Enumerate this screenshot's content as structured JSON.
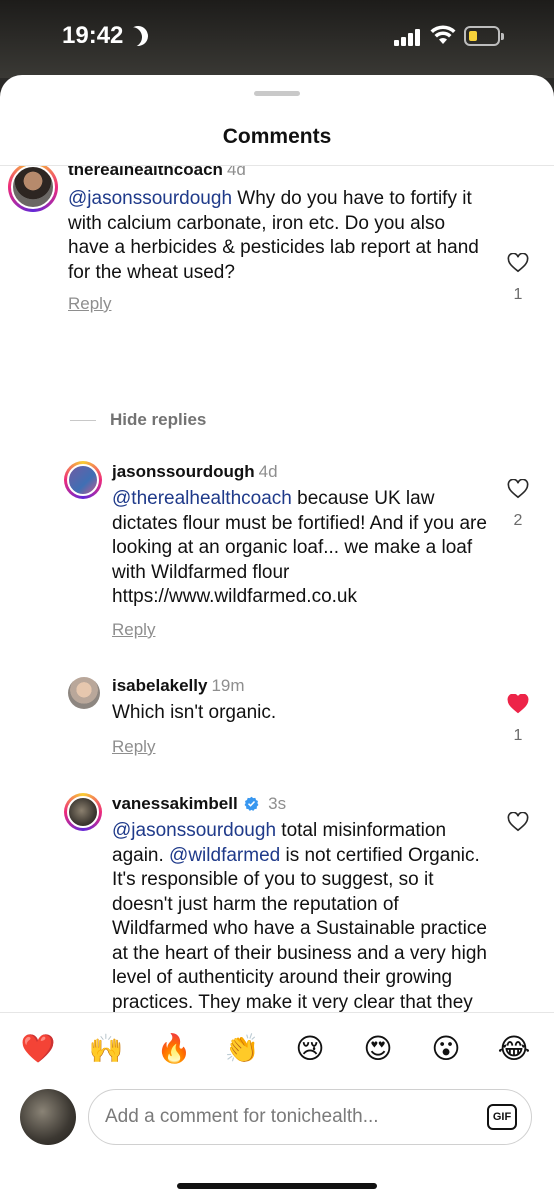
{
  "status_bar": {
    "time": "19:42"
  },
  "sheet": {
    "title": "Comments"
  },
  "comments": [
    {
      "username": "therealhealthcoach",
      "time": "4d",
      "mention": "@jasonssourdough",
      "text": " Why do you have to fortify it with calcium carbonate, iron etc. Do you also have a herbicides & pesticides lab report at hand for the wheat used?",
      "reply_label": "Reply",
      "likes": "1",
      "liked": false
    },
    {
      "username": "jasonssourdough",
      "time": "4d",
      "mention": "@therealhealthcoach",
      "text": " because UK law dictates flour must be fortified! And if you are looking at an organic loaf... we make a loaf with Wildfarmed flour https://www.wildfarmed.co.uk",
      "reply_label": "Reply",
      "likes": "2",
      "liked": false
    },
    {
      "username": "isabelakelly",
      "time": "19m",
      "text": "Which isn't organic.",
      "reply_label": "Reply",
      "likes": "1",
      "liked": true
    },
    {
      "username": "vanessakimbell",
      "time": "3s",
      "verified": true,
      "mention": "@jasonssourdough",
      "text_a": " total misinformation again.  ",
      "mention_b": "@wildfarmed",
      "text_b": " is not certified Organic. It's  responsible of you to suggest, so it doesn't just harm the reputation of Wildfarmed who have a Sustainable practice at the heart of their business and a very high level of authenticity around their growing practices. They make it very clear that they are about regenerative farming practices not organic.... you are",
      "liked": false
    }
  ],
  "hide_replies_label": "Hide replies",
  "reactions": [
    "❤️",
    "🙌",
    "🔥",
    "👏",
    "😢",
    "😍",
    "😮",
    "😂"
  ],
  "composer": {
    "placeholder": "Add a comment for tonichealth...",
    "gif_label": "GIF"
  },
  "colors": {
    "like_red": "#ed2448",
    "mention_blue": "#1f3a8a",
    "verified_blue": "#3897f0"
  }
}
